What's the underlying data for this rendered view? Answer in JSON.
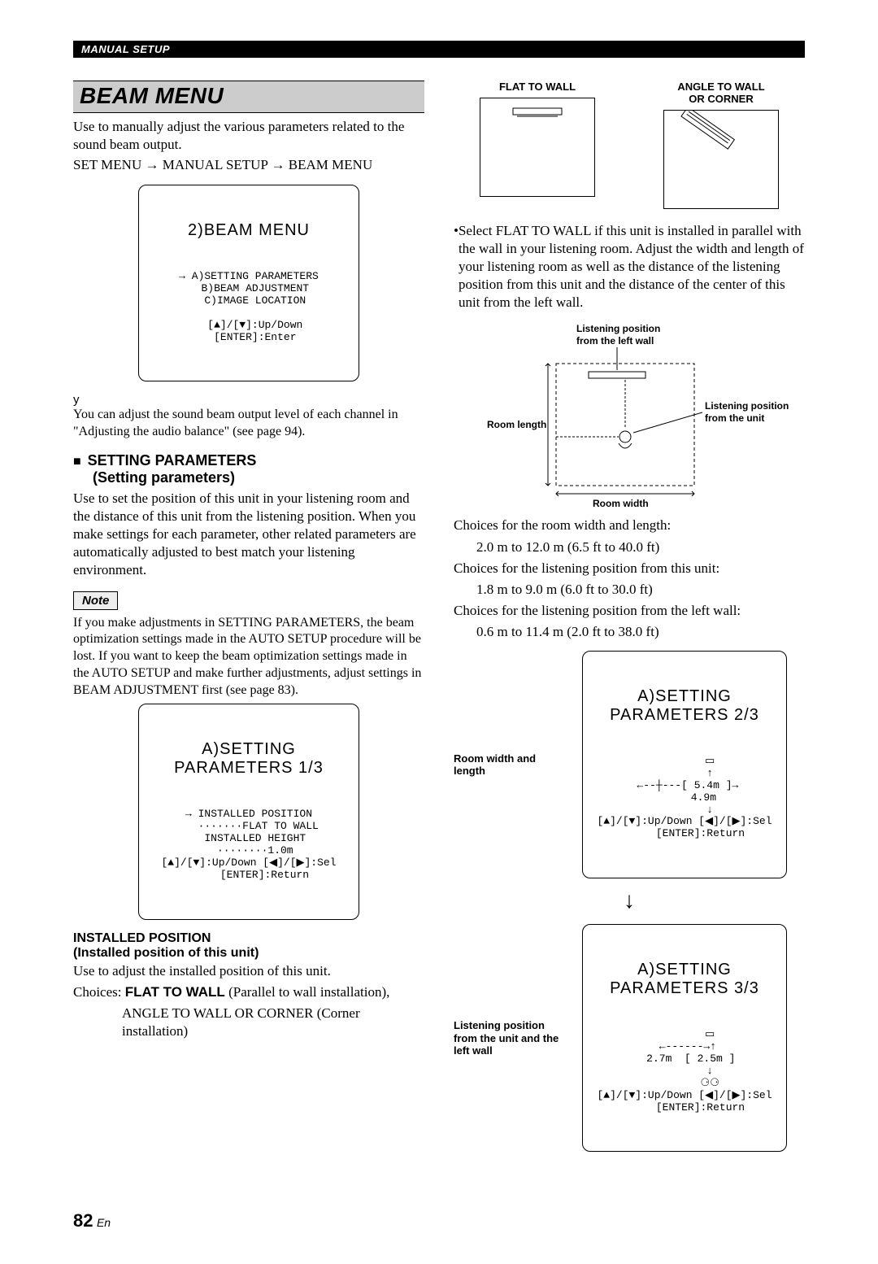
{
  "header": "MANUAL SETUP",
  "title": "BEAM MENU",
  "intro": "Use to manually adjust the various parameters related to the sound beam output.",
  "breadcrumb": [
    "SET MENU",
    "MANUAL SETUP",
    "BEAM MENU"
  ],
  "lcd_main": {
    "title": "2)BEAM MENU",
    "body": "→ A)SETTING PARAMETERS\n  B)BEAM ADJUSTMENT\n  C)IMAGE LOCATION\n\n  [▲]/[▼]:Up/Down\n  [ENTER]:Enter"
  },
  "tip_symbol": "y",
  "tip_text": "You can adjust the sound beam output level of each channel in \"Adjusting the audio balance\" (see page 94).",
  "section_setting": {
    "head1": "SETTING PARAMETERS",
    "head2": "(Setting parameters)",
    "body": "Use to set the position of this unit in your listening room and the distance of this unit from the listening position. When you make settings for each parameter, other related parameters are automatically adjusted to best match your listening environment."
  },
  "note_label": "Note",
  "note_body": "If you make adjustments in SETTING PARAMETERS, the beam optimization settings made in the AUTO SETUP procedure will be lost. If you want to keep the beam optimization settings made in the AUTO SETUP and make further adjustments, adjust settings in BEAM ADJUSTMENT first (see page 83).",
  "lcd_sp1": {
    "title": "A)SETTING PARAMETERS 1/3",
    "body": "→ INSTALLED POSITION\n   ·······FLAT TO WALL\n  INSTALLED HEIGHT\n  ········1.0m\n[▲]/[▼]:Up/Down [◀]/[▶]:Sel\n     [ENTER]:Return"
  },
  "installed_position": {
    "head1": "INSTALLED POSITION",
    "head2": "(Installed position of this unit)",
    "body": "Use to adjust the installed position of this unit.",
    "choices_label": "Choices: ",
    "choice1_bold": "FLAT TO WALL",
    "choice1_rest": " (Parallel to wall installation), ",
    "choice2": "ANGLE TO WALL OR CORNER (Corner installation)"
  },
  "right": {
    "dia_labels": {
      "flat": "FLAT TO WALL",
      "angle": "ANGLE TO WALL\nOR CORNER"
    },
    "bullet": "Select FLAT TO WALL if this unit is installed in parallel with the wall in your listening room. Adjust the width and length of your listening room as well as the distance of the listening position from this unit and the distance of the center of this unit from the left wall.",
    "room_labels": {
      "lp_left": "Listening position\nfrom the left wall",
      "lp_unit": "Listening position\nfrom the unit",
      "room_length": "Room length",
      "room_width": "Room width"
    },
    "choices": {
      "c1": "Choices for the room width and length:",
      "c1v": "2.0 m to 12.0 m (6.5 ft to 40.0 ft)",
      "c2": "Choices for the listening position from this unit:",
      "c2v": "1.8 m to 9.0 m (6.0 ft to 30.0 ft)",
      "c3": "Choices for the listening position from the left wall:",
      "c3v": "0.6 m to 11.4 m (2.0 ft to 38.0 ft)"
    },
    "lcd_sp2": {
      "title": "A)SETTING PARAMETERS 2/3",
      "label": "Room width and length",
      "body": "        ▭\n        ↑\n ←--┼---[ 5.4m ]→\n      4.9m\n        ↓\n[▲]/[▼]:Up/Down [◀]/[▶]:Sel\n     [ENTER]:Return"
    },
    "lcd_sp3": {
      "title": "A)SETTING PARAMETERS 3/3",
      "label": "Listening position from the unit and the left wall",
      "body": "        ▭\n ←------→↑\n  2.7m  [ 2.5m ]\n        ↓\n        ⚆⚆\n[▲]/[▼]:Up/Down [◀]/[▶]:Sel\n     [ENTER]:Return"
    }
  },
  "page_num": "82",
  "page_lang": "En"
}
